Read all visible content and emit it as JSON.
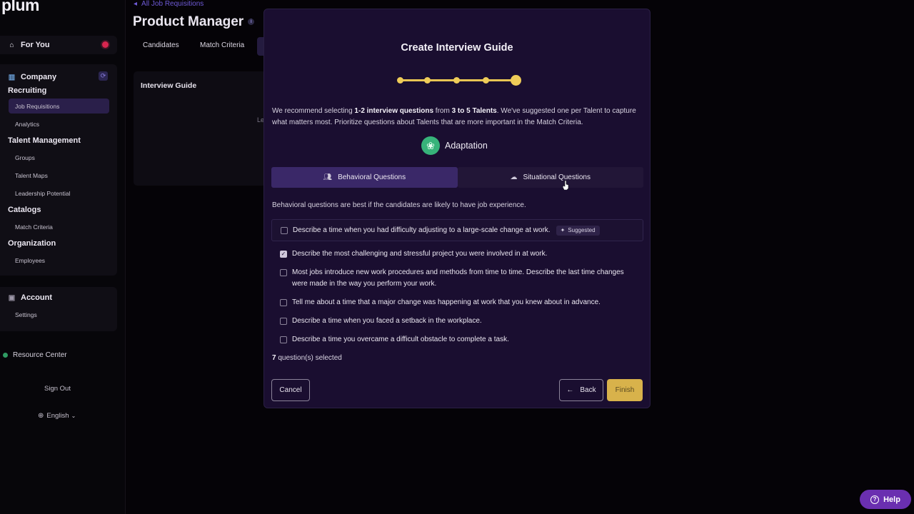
{
  "app": {
    "logo": "plum"
  },
  "sidebar": {
    "for_you": "For You",
    "company_recruiting": "Company Recruiting",
    "recruiting_items": [
      "Job Requisitions",
      "Analytics"
    ],
    "talent_management": "Talent Management",
    "talent_items": [
      "Groups",
      "Talent Maps",
      "Leadership Potential"
    ],
    "catalogs": "Catalogs",
    "catalog_items": [
      "Match Criteria"
    ],
    "organization": "Organization",
    "organization_items": [
      "Employees"
    ],
    "account": "Account",
    "account_items": [
      "Settings"
    ],
    "resource_center": "Resource Center",
    "sign_out": "Sign Out",
    "language": "English"
  },
  "page": {
    "breadcrumb": "All Job Requisitions",
    "title": "Product Manager",
    "tabs": [
      "Candidates",
      "Match Criteria"
    ],
    "card_title": "Interview Guide",
    "card_stub": "Le"
  },
  "modal": {
    "title": "Create Interview Guide",
    "steps_total": 5,
    "current_step": 5,
    "intro_parts": [
      "We recommend selecting ",
      "1-2 interview questions",
      " from ",
      "3 to 5 Talents",
      ". We've suggested one per Talent to capture what matters most. Prioritize questions about Talents that are more important in the Match Criteria."
    ],
    "talent": "Adaptation",
    "tabs": [
      "Behavioral Questions",
      "Situational Questions"
    ],
    "active_tab": 0,
    "tab_description": "Behavioral questions are best if the candidates are likely to have job experience.",
    "questions": [
      {
        "text": "Describe a time when you had difficulty adjusting to a large-scale change at work.",
        "checked": false,
        "badge": "Suggested"
      },
      {
        "text": "Describe the most challenging and stressful project you were involved in at work.",
        "checked": true
      },
      {
        "text": "Most jobs introduce new work procedures and methods from time to time. Describe the last time changes were made in the way you perform your work.",
        "checked": false
      },
      {
        "text": "Tell me about a time that a major change was happening at work that you knew about in advance.",
        "checked": false
      },
      {
        "text": "Describe a time when you faced a setback in the workplace.",
        "checked": false
      },
      {
        "text": "Describe a time you overcame a difficult obstacle to complete a task.",
        "checked": false
      }
    ],
    "selected_count": "7",
    "selected_label": " question(s) selected",
    "cancel": "Cancel",
    "back": "Back",
    "finish": "Finish"
  },
  "help": "Help",
  "colors": {
    "accent": "#e8c553",
    "modal_bg": "#1a0e30",
    "help": "#6a2fb0",
    "finish": "#d8b24b"
  }
}
